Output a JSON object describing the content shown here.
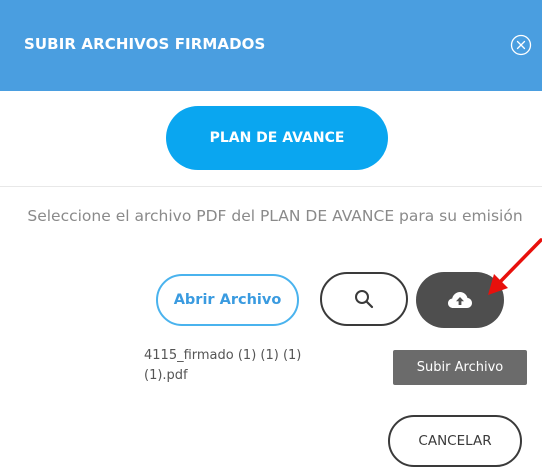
{
  "dialog": {
    "title": "SUBIR ARCHIVOS FIRMADOS",
    "close_icon": "circle-x-icon",
    "header_color": "#4a9ee0"
  },
  "tab": {
    "label": "PLAN DE AVANCE",
    "color": "#0aa6f0"
  },
  "instruction": "Seleccione el archivo PDF del PLAN DE AVANCE para su emisión",
  "buttons": {
    "open_label": "Abrir Archivo",
    "search_icon": "search-icon",
    "upload_icon": "cloud-upload-icon",
    "cancel_label": "CANCELAR"
  },
  "file": {
    "name": "4115_firmado (1) (1) (1) (1).pdf"
  },
  "tooltip": {
    "text": "Subir Archivo"
  },
  "annotation": {
    "arrow_color": "#e8100c"
  }
}
